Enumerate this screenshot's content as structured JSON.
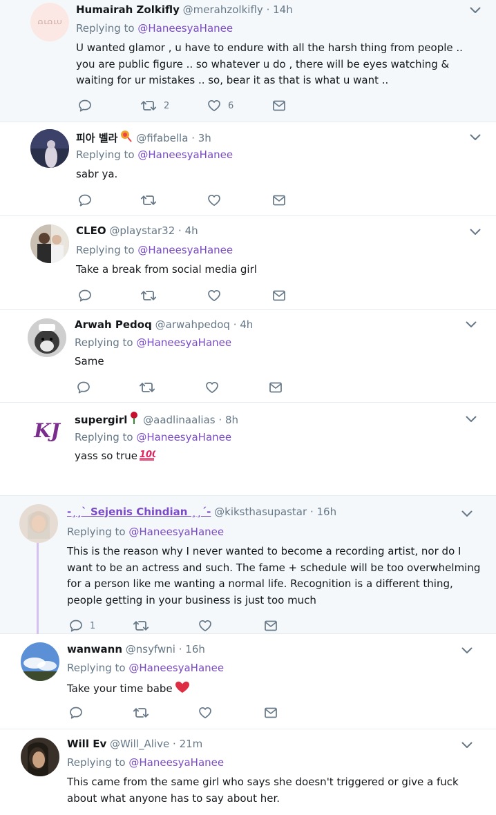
{
  "reply_prefix": "Replying to",
  "reply_mention": "@HaneesyaHanee",
  "colors": {
    "accent": "#794bc4",
    "muted": "#657786",
    "heart": "#e0245e",
    "thread": "#d4c1ef"
  },
  "icons": {
    "reply": "reply-icon",
    "retweet": "retweet-icon",
    "like": "heart-icon",
    "dm": "envelope-icon",
    "more": "chevron-down-icon"
  },
  "tweets": [
    {
      "name": "Humairah Zolkifly",
      "handle": "@merahzolkifly",
      "sep": "·",
      "time": "14h",
      "text": "U wanted glamor , u have to endure with all the harsh thing from people .. you are public figure .. so whatever u do , there will be eyes watching & waiting for ur mistakes .. so, bear it as that is what u want ..",
      "retweets": "2",
      "likes": "6",
      "avatar_text": "ᗩ ᒪᗩ ᒪᑌ"
    },
    {
      "name": "피아 벨라",
      "handle": "@fifabella",
      "sep": "·",
      "time": "3h",
      "text": "sabr ya."
    },
    {
      "name": "CLEO",
      "handle": "@playstar32",
      "sep": "·",
      "time": "4h",
      "text": "Take a break from social media girl"
    },
    {
      "name": "Arwah Pedoq",
      "handle": "@arwahpedoq",
      "sep": "·",
      "time": "4h",
      "text": "Same"
    },
    {
      "name": "supergirl",
      "handle": "@aadlinaalias",
      "sep": "·",
      "time": "8h",
      "text": "yass so true",
      "avatar_text": "KJ"
    },
    {
      "name": "-¸¸` Sejenis Chindian ¸¸´-",
      "handle": "@kiksthasupastar",
      "sep": "·",
      "time": "16h",
      "text": "This is the reason why I never wanted to become a recording artist, nor do I want to be an actress and such. The fame + schedule will be too overwhelming for a person like me wanting a normal life. Recognition is a different thing, people getting in your business is just too much",
      "replies": "1"
    },
    {
      "name": "wanwann",
      "handle": "@nsyfwni",
      "sep": "·",
      "time": "16h",
      "text": "Take your time babe"
    },
    {
      "name": "Will Ev",
      "handle": "@Will_Alive",
      "sep": "·",
      "time": "21m",
      "text": "This came from the same girl who says she doesn't triggered or give a fuck about what anyone has to say about her."
    }
  ]
}
